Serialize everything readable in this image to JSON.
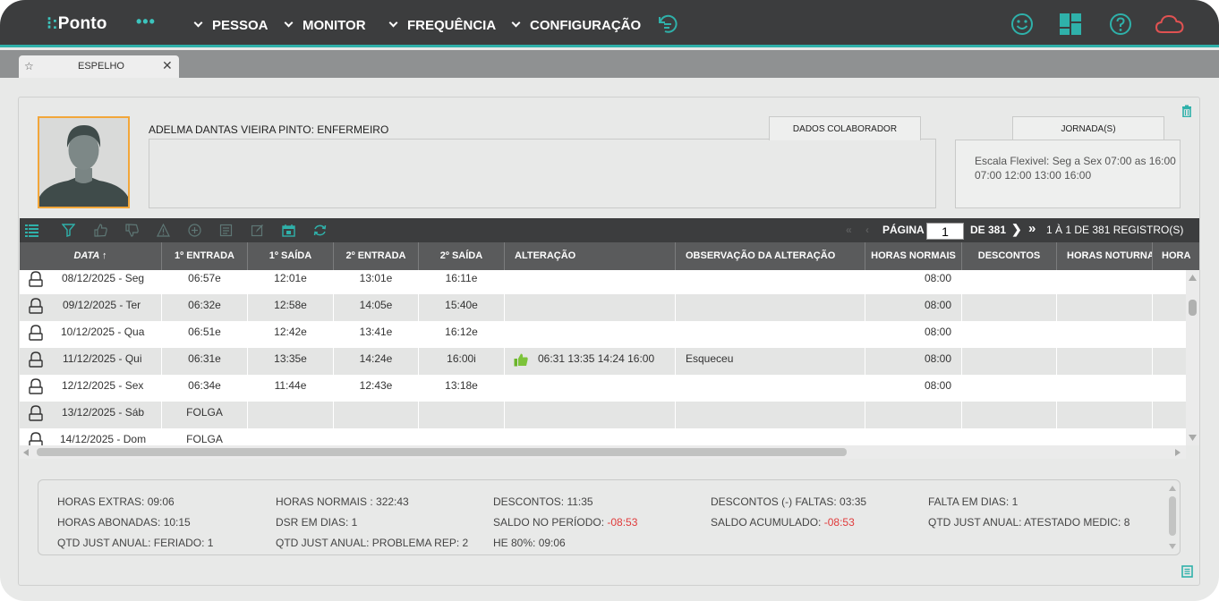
{
  "app": {
    "logo_text": "Ponto",
    "more_label": "•••",
    "menu": [
      {
        "label": "PESSOA"
      },
      {
        "label": "MONITOR"
      },
      {
        "label": "FREQUÊNCIA"
      },
      {
        "label": "CONFIGURAÇÃO"
      }
    ],
    "top_icons": [
      "history-icon",
      "smiley-icon",
      "dashboard-icon",
      "help-icon",
      "cloud-icon"
    ],
    "accent_color": "#2fb1aa",
    "danger_color": "#e03b3b"
  },
  "tab": {
    "label": "ESPELHO",
    "close": "✕",
    "star": "☆"
  },
  "employee": {
    "name_role": "ADELMA DANTAS VIEIRA PINTO:  ENFERMEIRO",
    "tab_colaborador": "DADOS COLABORADOR",
    "tab_jornada": "JORNADA(S)",
    "jornada_line1": "Escala Flexivel: Seg a Sex 07:00 as 16:00",
    "jornada_line2": "07:00 12:00 13:00 16:00"
  },
  "pager": {
    "pagina_label": "PÁGINA",
    "page_value": "1",
    "of_label": "DE 381",
    "records_label": "1 À 1 DE 381 REGISTRO(S)"
  },
  "grid": {
    "columns": [
      {
        "label": "DATA ↑"
      },
      {
        "label": "1º ENTRADA"
      },
      {
        "label": "1º SAÍDA"
      },
      {
        "label": "2º ENTRADA"
      },
      {
        "label": "2º SAÍDA"
      },
      {
        "label": "ALTERAÇÃO"
      },
      {
        "label": "OBSERVAÇÃO DA ALTERAÇÃO"
      },
      {
        "label": "HORAS NORMAIS"
      },
      {
        "label": "DESCONTOS"
      },
      {
        "label": "HORAS NOTURNA"
      },
      {
        "label": "HORA"
      }
    ],
    "rows": [
      {
        "date": "08/12/2025 - Seg",
        "e1": "06:57e",
        "s1": "12:01e",
        "e2": "13:01e",
        "s2": "16:11e",
        "alt": "",
        "obs": "",
        "hn": "08:00"
      },
      {
        "date": "09/12/2025 - Ter",
        "e1": "06:32e",
        "s1": "12:58e",
        "e2": "14:05e",
        "s2": "15:40e",
        "alt": "",
        "obs": "",
        "hn": "08:00"
      },
      {
        "date": "10/12/2025 - Qua",
        "e1": "06:51e",
        "s1": "12:42e",
        "e2": "13:41e",
        "s2": "16:12e",
        "alt": "",
        "obs": "",
        "hn": "08:00"
      },
      {
        "date": "11/12/2025 - Qui",
        "e1": "06:31e",
        "s1": "13:35e",
        "e2": "14:24e",
        "s2": "16:00i",
        "alt": "06:31 13:35 14:24 16:00",
        "obs": "Esqueceu",
        "hn": "08:00"
      },
      {
        "date": "12/12/2025 - Sex",
        "e1": "06:34e",
        "s1": "11:44e",
        "e2": "12:43e",
        "s2": "13:18e",
        "alt": "",
        "obs": "",
        "hn": "08:00"
      },
      {
        "date": "13/12/2025 - Sáb",
        "e1": "FOLGA",
        "s1": "",
        "e2": "",
        "s2": "",
        "alt": "",
        "obs": "",
        "hn": ""
      },
      {
        "date": "14/12/2025 - Dom",
        "e1": "FOLGA",
        "s1": "",
        "e2": "",
        "s2": "",
        "alt": "",
        "obs": "",
        "hn": ""
      }
    ]
  },
  "summary": {
    "horas_extras": "HORAS EXTRAS: 09:06",
    "horas_normais": "HORAS NORMAIS : 322:43",
    "descontos": "DESCONTOS: 11:35",
    "descontos_faltas": "DESCONTOS (-) FALTAS: 03:35",
    "falta_dias": "FALTA EM DIAS: 1",
    "horas_abonadas": "HORAS ABONADAS: 10:15",
    "dsr_dias": "DSR EM DIAS: 1",
    "saldo_periodo_label": "SALDO NO PERÍODO:",
    "saldo_periodo_value": "-08:53",
    "saldo_acumulado_label": "SALDO ACUMULADO:",
    "saldo_acumulado_value": "-08:53",
    "just_atestado": "QTD JUST ANUAL: ATESTADO MEDIC: 8",
    "just_feriado": "QTD JUST ANUAL: FERIADO: 1",
    "just_problema": "QTD JUST ANUAL: PROBLEMA REP: 2",
    "he80": "HE 80%: 09:06"
  }
}
